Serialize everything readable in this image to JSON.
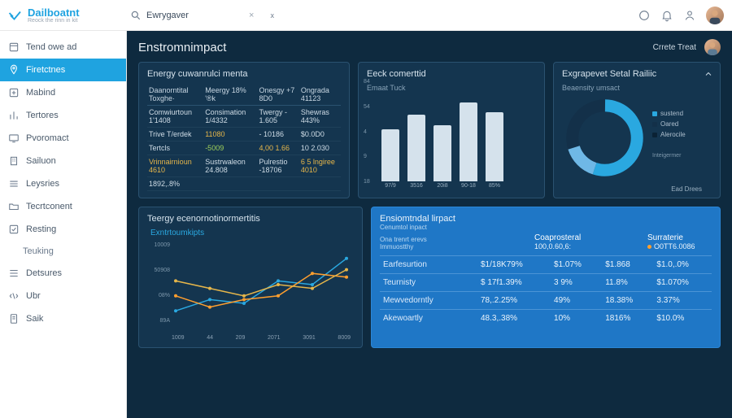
{
  "logo": {
    "title": "Dailboatnt",
    "subtitle": "Reock the rinn in kit"
  },
  "search": {
    "value": "Ewrygaver",
    "chip2": "x"
  },
  "sidebar": {
    "items": [
      {
        "label": "Tend owe ad"
      },
      {
        "label": "Firetctnes"
      },
      {
        "label": "Mabind"
      },
      {
        "label": "Tertores"
      },
      {
        "label": "Pvoromact"
      },
      {
        "label": "Sailuon"
      },
      {
        "label": "Leysries"
      },
      {
        "label": "Tecrtconent"
      },
      {
        "label": "Resting"
      },
      {
        "label": "Teuking"
      },
      {
        "label": "Detsures"
      },
      {
        "label": "Ubr"
      },
      {
        "label": "Saik"
      }
    ]
  },
  "page": {
    "title": "Enstromnimpact",
    "create_label": "Crrete Treat"
  },
  "energy_table": {
    "title": "Energy cuwanrulci menta",
    "headers": [
      "Daanorntital\nToxghe·",
      "Meergy\n18% '®k",
      "Onesgy\n+7 8D0",
      "Ongrada\n41123"
    ],
    "rows": [
      [
        "Comwiurtoun\n1'1408",
        "Consimation\n1/4332",
        "Twergy\n- 1.605",
        "Shewras\n443%"
      ],
      [
        "Trive T/erdek",
        "11080",
        "- 10186",
        "$0.0D0"
      ],
      [
        "Tertcls",
        "-5009",
        "4,00 1.66",
        "10 2.030"
      ],
      [
        "Vrinnairnioun\n4610",
        "Sustrwaleon\n24.808",
        "Pulrestio\n-18706",
        "6 5 lngiree\n4010"
      ],
      [
        "1892,.8%",
        "",
        "",
        ""
      ]
    ]
  },
  "bar_card": {
    "title": "Eeck comerttid",
    "subtitle": "Emaat Tuck"
  },
  "donut_card": {
    "title": "Exgrapevet Setal Railiic",
    "subtitle": "Beaensity umsact",
    "legend": [
      {
        "label": "sustend",
        "color": "#2aa8e0"
      },
      {
        "label": "Oared",
        "color": "#133049"
      },
      {
        "label": "Alerocile",
        "color": "#0b2235"
      }
    ],
    "side_label": "Inteigermer",
    "footer": "Ead Drees"
  },
  "line_card": {
    "title": "Teergy ecenornotinormertitis",
    "series_label": "Exntrtoumkipts"
  },
  "impact_card": {
    "title": "Ensiomtndal lirpact",
    "subtitle": "Cenumtol inpact",
    "head_cols": [
      {
        "l1": "Ona trenrt erevs",
        "l2": "Immuostthy"
      },
      {
        "l1": "Coaprosteral",
        "l2": "100,0.60,6:"
      },
      {
        "l1": "Surraterie",
        "l2": "O0TT6.0086"
      }
    ],
    "rows": [
      [
        "Earfesurtion",
        "$1/18K79%",
        "$1.07%",
        "$1.868",
        "$1.0,.0%"
      ],
      [
        "Teurnisty",
        "$ 17f1.39%",
        "3 9%",
        "11.8%",
        "$1.070%"
      ],
      [
        "Mewvedorntly",
        "78,.2.25%",
        "49%",
        "18.38%",
        "3.37%"
      ],
      [
        "Akewoartly",
        "48.3,.38%",
        "10%",
        "1816%",
        "$10.0%"
      ]
    ]
  },
  "chart_data": [
    {
      "type": "bar",
      "title": "Eeck comerttid",
      "subtitle": "Emaat Tuck",
      "categories": [
        "97/9",
        "3516",
        "20i8",
        "90-18",
        "85%"
      ],
      "values": [
        54,
        70,
        59,
        82,
        72
      ],
      "y_ticks": [
        "84",
        "54",
        "4",
        "9",
        "18"
      ],
      "ylim": [
        0,
        90
      ]
    },
    {
      "type": "pie",
      "title": "Exgrapevet Setal Railiic",
      "series": [
        {
          "name": "sustend",
          "value": 55,
          "color": "#2aa8e0"
        },
        {
          "name": "Oared",
          "value": 30,
          "color": "#133049"
        },
        {
          "name": "Alerocile",
          "value": 15,
          "color": "#6fb8e6"
        }
      ]
    },
    {
      "type": "line",
      "title": "Teergy ecenornotinormertitis",
      "x": [
        1009,
        44,
        209,
        2071,
        3091,
        8009
      ],
      "y_ticks": [
        "10009",
        "50908",
        "08%",
        "89A"
      ],
      "series": [
        {
          "name": "blue",
          "color": "#2aa8e0",
          "values": [
            15,
            30,
            25,
            55,
            50,
            85
          ]
        },
        {
          "name": "orange",
          "color": "#ff9f2e",
          "values": [
            35,
            20,
            30,
            35,
            65,
            60
          ]
        },
        {
          "name": "gold",
          "color": "#e6b64a",
          "values": [
            55,
            45,
            35,
            50,
            45,
            70
          ]
        }
      ],
      "ylim": [
        0,
        100
      ]
    }
  ]
}
